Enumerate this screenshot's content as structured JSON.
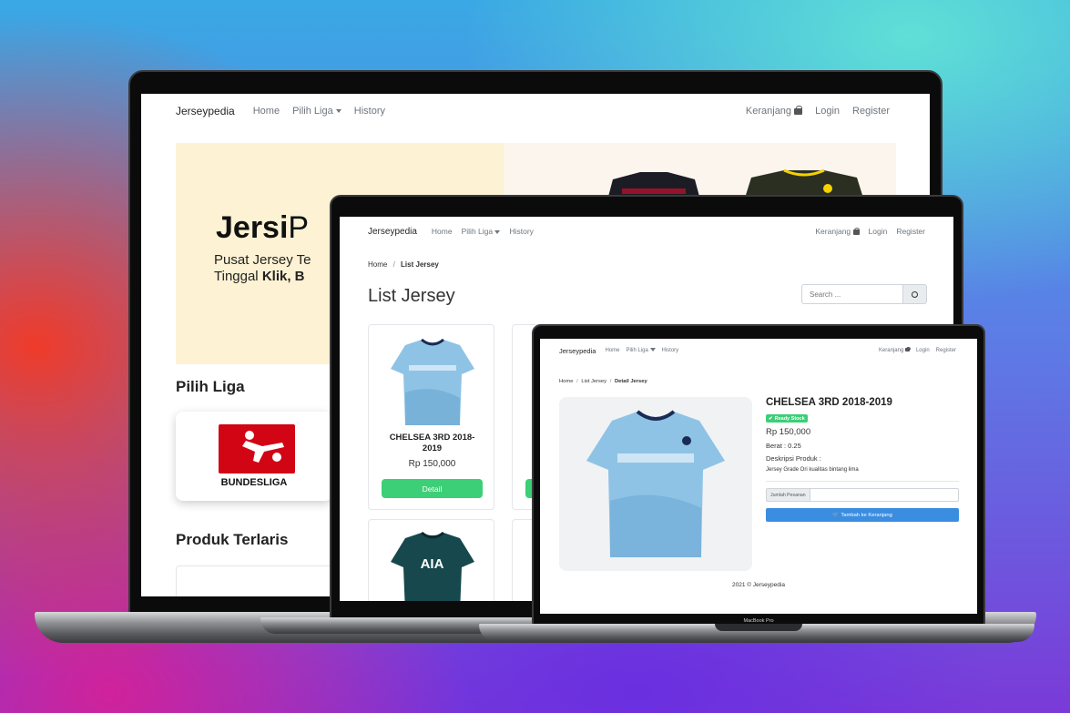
{
  "nav": {
    "brand": "Jerseypedia",
    "home": "Home",
    "league": "Pilih Liga",
    "history": "History",
    "cart": "Keranjang",
    "login": "Login",
    "register": "Register"
  },
  "back_screen": {
    "hero_title_bold": "Jersi",
    "hero_title_light": "P",
    "hero_line1": "Pusat Jersey Te",
    "hero_line2_prefix": "Tinggal ",
    "hero_line2_bold": "Klik, B",
    "section_league": "Pilih Liga",
    "league_name": "BUNDESLIGA",
    "section_best": "Produk Terlaris"
  },
  "middle_screen": {
    "breadcrumb_home": "Home",
    "breadcrumb_sep": "/",
    "breadcrumb_current": "List Jersey",
    "title": "List Jersey",
    "search_placeholder": "Search ...",
    "product_name_line1": "CHELSEA 3RD 2018-",
    "product_name_line2": "2019",
    "product_price": "Rp 150,000",
    "detail_button": "Detail",
    "second_shirt_text": "AIA"
  },
  "front_screen": {
    "breadcrumb_home": "Home",
    "breadcrumb_list": "List Jersey",
    "breadcrumb_current": "Detail Jersey",
    "product_title": "CHELSEA 3RD 2018-2019",
    "stock_badge": "Ready Stock",
    "price": "Rp 150,000",
    "weight": "Berat : 0.25",
    "desc_label": "Deskripsi Produk :",
    "desc_text": "Jersey Grade Ori kualitas bintang lima",
    "qty_label": "Jumlah Pesanan",
    "add_cart_button": "Tambah ke Keranjang",
    "footer": "2021 © Jerseypedia",
    "device_label": "MacBook Pro"
  },
  "colors": {
    "green": "#3ccf77",
    "blue": "#3a8de0",
    "hero_bg": "#fdf2d3",
    "shirt_blue": "#8ec3e6",
    "bundesliga_red": "#d20515"
  }
}
